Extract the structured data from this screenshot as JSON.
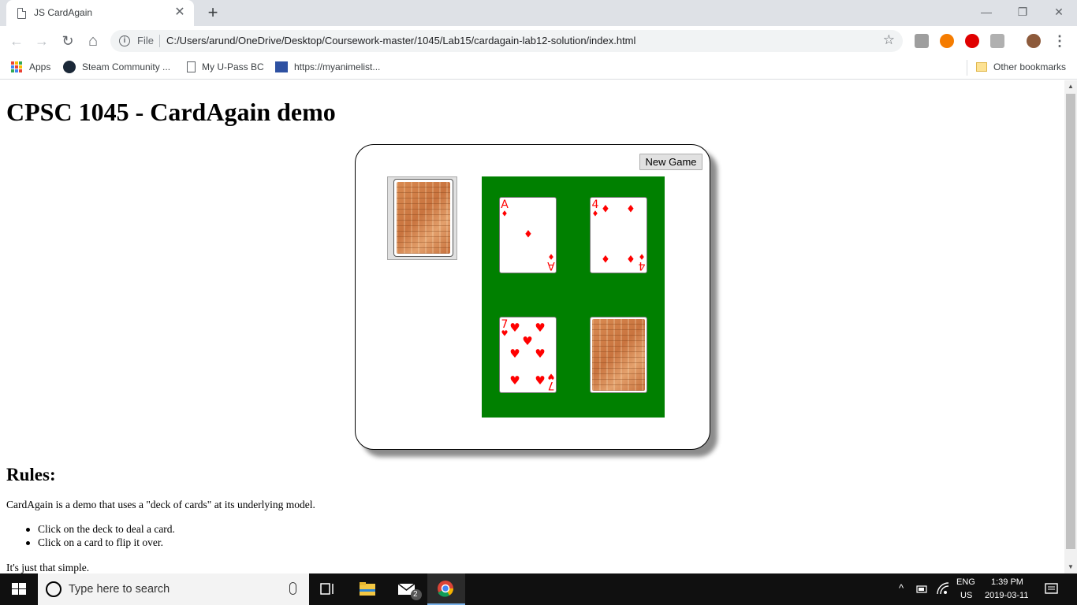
{
  "browser": {
    "tab_title": "JS CardAgain",
    "tab_close": "✕",
    "new_tab": "+",
    "url_scheme_label": "File",
    "url": "C:/Users/arund/OneDrive/Desktop/Coursework-master/1045/Lab15/cardagain-lab12-solution/index.html",
    "window_controls": {
      "minimize": "—",
      "restore": "❐",
      "close": "✕"
    },
    "nav": {
      "back": "←",
      "forward": "→",
      "reload": "↻",
      "home": "⌂",
      "info": "i",
      "star": "☆",
      "menu": "⋮"
    }
  },
  "bookmarks": {
    "items": [
      {
        "label": "Apps",
        "icon": "apps-grid-icon"
      },
      {
        "label": "Steam Community ...",
        "icon": "steam-icon"
      },
      {
        "label": "My U-Pass BC",
        "icon": "page-icon"
      },
      {
        "label": "https://myanimelist...",
        "icon": "mal-icon"
      }
    ],
    "other": "Other bookmarks"
  },
  "page": {
    "title": "CPSC 1045 - CardAgain demo",
    "new_game_label": "New Game",
    "rules_heading": "Rules:",
    "rules_desc": "CardAgain is a demo that uses a \"deck of cards\" at its underlying model.",
    "rules_items": [
      "Click on the deck to deal a card.",
      "Click on a card to flip it over."
    ],
    "rules_closing": "It's just that simple.",
    "cards": [
      {
        "rank": "A",
        "suit": "diamonds",
        "symbol": "♦",
        "face_up": true,
        "color": "#ff0000"
      },
      {
        "rank": "4",
        "suit": "diamonds",
        "symbol": "♦",
        "face_up": true,
        "color": "#ff0000"
      },
      {
        "rank": "7",
        "suit": "hearts",
        "symbol": "♥",
        "face_up": true,
        "color": "#ff0000"
      },
      {
        "rank": "",
        "suit": "",
        "symbol": "",
        "face_up": false,
        "color": "#c9743f"
      }
    ],
    "colors": {
      "table_green": "#008000",
      "card_red": "#ff0000"
    }
  },
  "taskbar": {
    "search_placeholder": "Type here to search",
    "lang_top": "ENG",
    "lang_bottom": "US",
    "time": "1:39 PM",
    "date": "2019-03-11",
    "mail_badge": "2",
    "tray_chevron": "^"
  }
}
